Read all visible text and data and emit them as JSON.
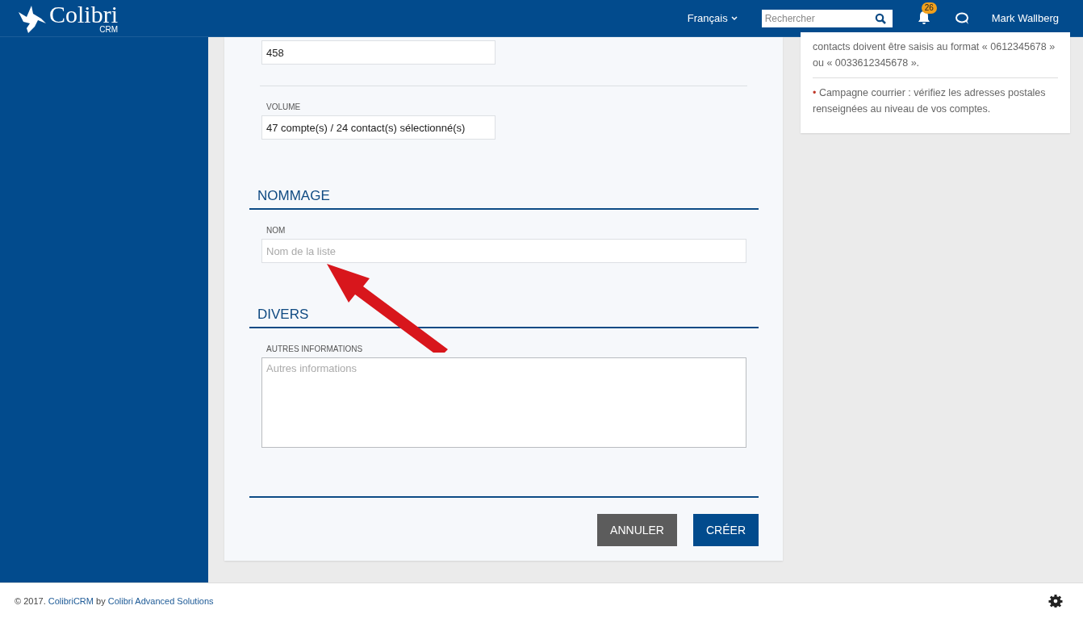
{
  "header": {
    "logo": {
      "name": "Colibri",
      "sub": "CRM"
    },
    "language": "Français",
    "search": {
      "placeholder": "Rechercher"
    },
    "notifications": {
      "count": "26"
    },
    "user": "Mark Wallberg"
  },
  "form": {
    "top_field": {
      "value": "458"
    },
    "volume": {
      "label": "VOLUME",
      "value": "47 compte(s) / 24 contact(s) sélectionné(s)"
    },
    "sections": [
      {
        "title": "NOMMAGE",
        "field": {
          "kind": "input",
          "label": "NOM",
          "placeholder": "Nom de la liste"
        }
      },
      {
        "title": "DIVERS",
        "field": {
          "kind": "textarea",
          "label": "AUTRES INFORMATIONS",
          "placeholder": "Autres informations"
        }
      }
    ],
    "buttons": [
      {
        "label": "ANNULER",
        "kind": "secondary"
      },
      {
        "label": "CRÉER",
        "kind": "primary"
      }
    ]
  },
  "notes": [
    {
      "text": "contacts doivent être saisis au format « 0612345678 » ou « 0033612345678 »."
    },
    {
      "bullet": "•",
      "text": "Campagne courrier : vérifiez les adresses postales renseignées au niveau de vos comptes."
    }
  ],
  "footer": {
    "prefix": "© 2017. ",
    "link1": "ColibriCRM",
    "middle": " by ",
    "link2": "Colibri Advanced Solutions"
  }
}
